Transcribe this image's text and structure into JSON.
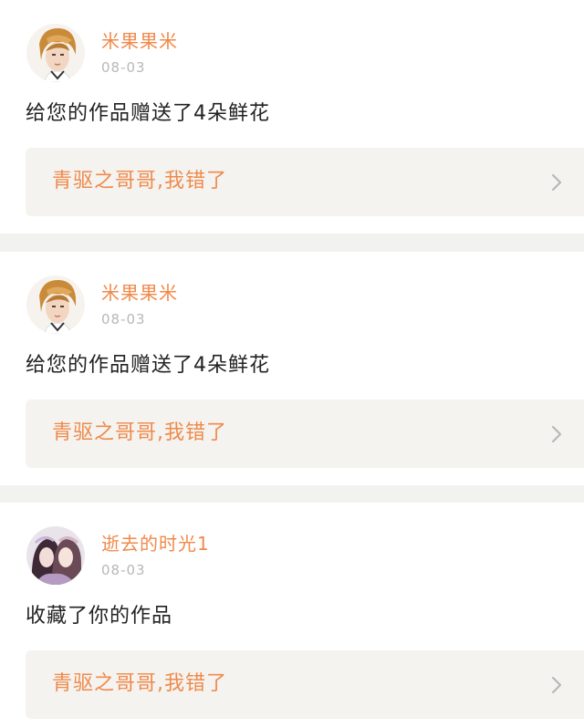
{
  "feed": {
    "items": [
      {
        "user": "米果果米",
        "date": "08-03",
        "message": "给您的作品赠送了4朵鲜花",
        "work_title": "青驱之哥哥,我错了",
        "avatar_icon": "user-avatar-orange-hair"
      },
      {
        "user": "米果果米",
        "date": "08-03",
        "message": "给您的作品赠送了4朵鲜花",
        "work_title": "青驱之哥哥,我错了",
        "avatar_icon": "user-avatar-orange-hair"
      },
      {
        "user": "逝去的时光1",
        "date": "08-03",
        "message": "收藏了你的作品",
        "work_title": "青驱之哥哥,我错了",
        "avatar_icon": "user-avatar-couple"
      }
    ]
  },
  "colors": {
    "accent": "#f08a4b",
    "date_gray": "#b8b8b8",
    "link_bg": "#f4f3ef",
    "separator": "#f2f2f0"
  }
}
